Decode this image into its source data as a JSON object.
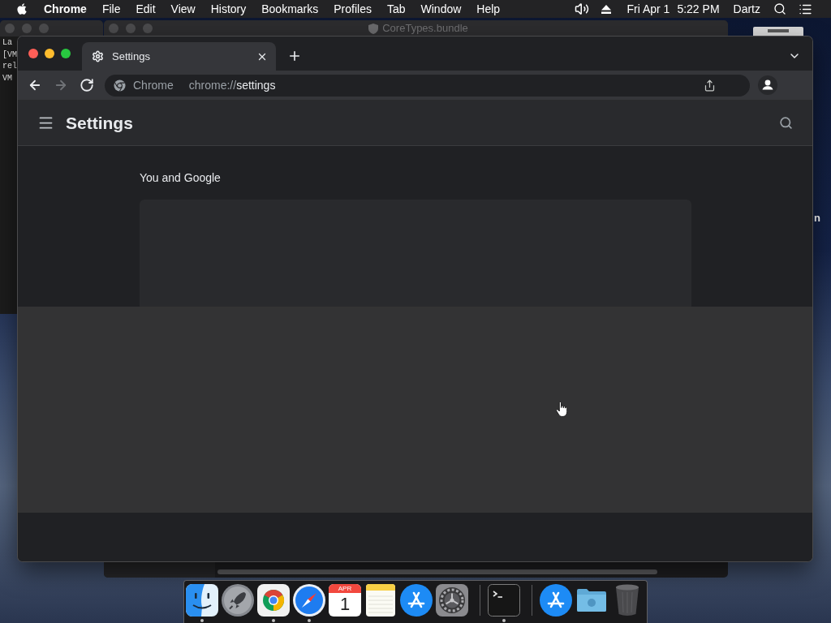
{
  "menu_bar": {
    "app_name": "Chrome",
    "menus": [
      "File",
      "Edit",
      "View",
      "History",
      "Bookmarks",
      "Profiles",
      "Tab",
      "Window",
      "Help"
    ],
    "date": "Fri Apr 1",
    "time": "5:22 PM",
    "user": "Dartz"
  },
  "terminal_window": {
    "lines": [
      "La",
      "[VM",
      "rel",
      "VM"
    ]
  },
  "finder_window": {
    "title": "CoreTypes.bundle"
  },
  "desktop_icons": [
    {
      "label": "n"
    }
  ],
  "browser": {
    "tabs": [
      {
        "title": "Settings",
        "selected": true
      }
    ],
    "nav_buttons": [
      {
        "kind": "back",
        "disabled": false
      },
      {
        "kind": "forward",
        "disabled": true
      },
      {
        "kind": "reload",
        "disabled": false
      }
    ],
    "omnibox": {
      "site_label": "Chrome",
      "url_scheme": "chrome://",
      "url_path": "settings"
    },
    "page": {
      "title": "Settings",
      "section_heading": "You and Google"
    }
  },
  "dock": {
    "sections": [
      {
        "items": [
          {
            "kind": "finder",
            "running": true
          },
          {
            "kind": "launchpad",
            "running": false
          },
          {
            "kind": "chrome",
            "running": true
          },
          {
            "kind": "safari",
            "running": true
          },
          {
            "kind": "calendar",
            "running": false,
            "month": "APR",
            "day": "1"
          },
          {
            "kind": "notes",
            "running": false
          },
          {
            "kind": "app_store",
            "running": false
          },
          {
            "kind": "system_preferences",
            "running": false
          }
        ]
      },
      {
        "items": [
          {
            "kind": "terminal",
            "running": true
          }
        ]
      },
      {
        "items": [
          {
            "kind": "app_store",
            "running": false
          },
          {
            "kind": "folder",
            "running": false
          },
          {
            "kind": "trash",
            "running": false
          }
        ]
      }
    ]
  }
}
